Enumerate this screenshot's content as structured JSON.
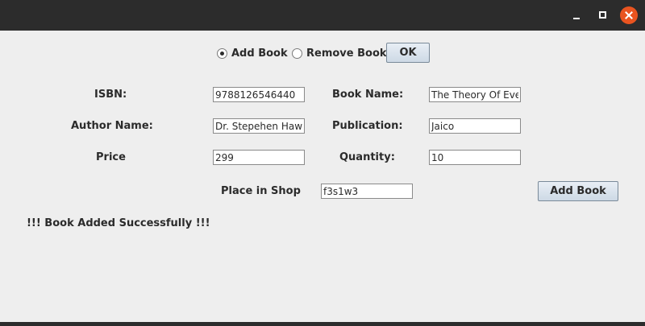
{
  "window": {
    "controls": {
      "minimize_icon": "minimize-icon",
      "maximize_icon": "maximize-icon",
      "close_icon": "close-icon"
    },
    "close_color": "#e95420"
  },
  "mode": {
    "add_label": "Add Book",
    "remove_label": "Remove Book",
    "selected": "Add Book",
    "ok_label": "OK"
  },
  "form": {
    "isbn_label": "ISBN:",
    "isbn_value": "9788126546440",
    "book_name_label": "Book Name:",
    "book_name_value": "The Theory Of Everything",
    "author_label": "Author Name:",
    "author_value": "Dr. Stepehen Hawking",
    "publication_label": "Publication:",
    "publication_value": "Jaico",
    "price_label": "Price",
    "price_value": "299",
    "quantity_label": "Quantity:",
    "quantity_value": "10",
    "place_label": "Place in Shop",
    "place_value": "f3s1w3",
    "submit_label": "Add Book"
  },
  "status": {
    "message": "!!! Book Added Successfully !!!"
  }
}
